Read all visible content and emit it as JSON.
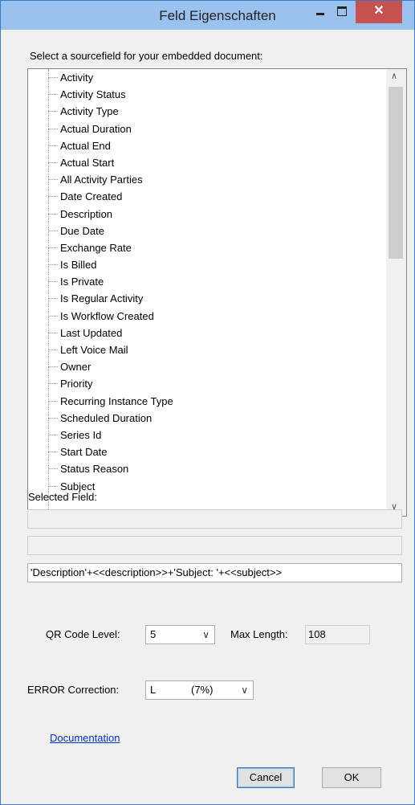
{
  "window": {
    "title": "Feld Eigenschaften",
    "close_glyph": "✕"
  },
  "source": {
    "label": "Select a sourcefield for your embedded document:",
    "items": [
      "Activity",
      "Activity Status",
      "Activity Type",
      "Actual Duration",
      "Actual End",
      "Actual Start",
      "All Activity Parties",
      "Date Created",
      "Description",
      "Due Date",
      "Exchange Rate",
      "Is Billed",
      "Is Private",
      "Is Regular Activity",
      "Is Workflow Created",
      "Last Updated",
      "Left Voice Mail",
      "Owner",
      "Priority",
      "Recurring Instance Type",
      "Scheduled Duration",
      "Series Id",
      "Start Date",
      "Status Reason",
      "Subject"
    ],
    "scroll_up": "∧",
    "scroll_down": "∨"
  },
  "selected_field": {
    "label": "Selected Field:",
    "value1": "",
    "value2": "",
    "expression": "'Description'+<<description>>+'Subject: '+<<subject>>"
  },
  "qr": {
    "level_label": "QR Code Level:",
    "level_value": "5",
    "maxlen_label": "Max Length:",
    "maxlen_value": "108"
  },
  "error": {
    "label": "ERROR Correction:",
    "value": "L",
    "percent": "(7%)"
  },
  "link": {
    "documentation": "Documentation"
  },
  "buttons": {
    "cancel": "Cancel",
    "ok": "OK"
  },
  "chevron": "∨"
}
